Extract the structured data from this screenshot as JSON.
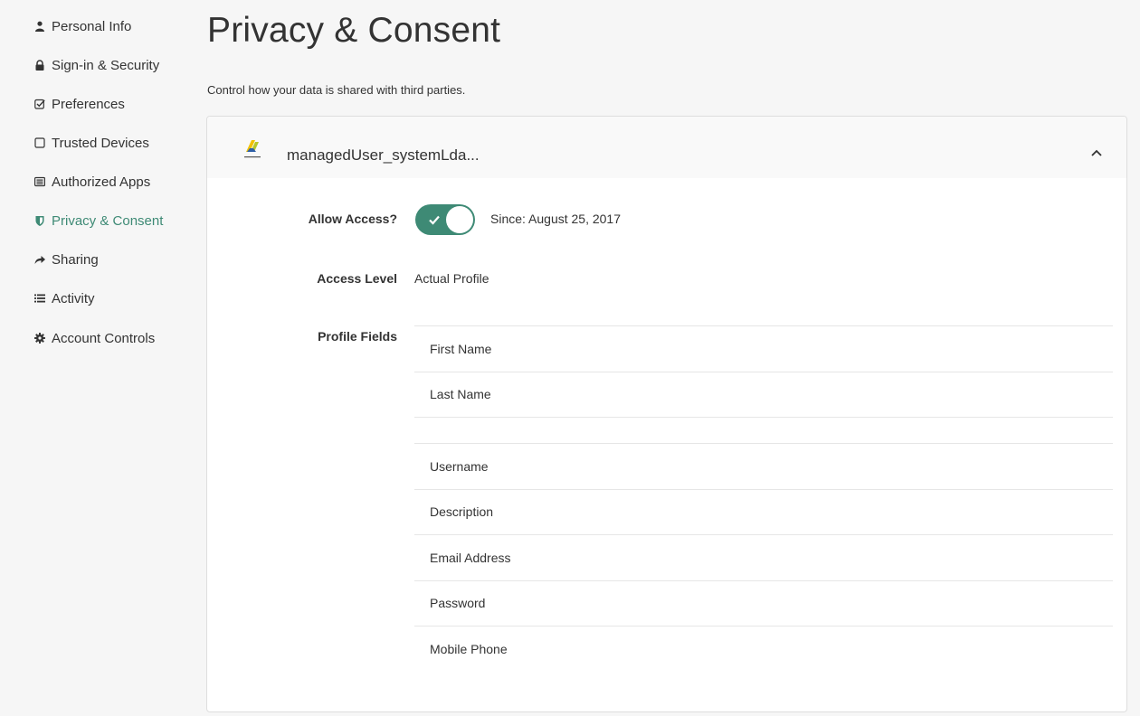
{
  "sidebar": {
    "items": [
      {
        "label": "Personal Info",
        "icon": "user-icon",
        "active": false
      },
      {
        "label": "Sign-in & Security",
        "icon": "lock-icon",
        "active": false
      },
      {
        "label": "Preferences",
        "icon": "checkbox-icon",
        "active": false
      },
      {
        "label": "Trusted Devices",
        "icon": "square-icon",
        "active": false
      },
      {
        "label": "Authorized Apps",
        "icon": "list-box-icon",
        "active": false
      },
      {
        "label": "Privacy & Consent",
        "icon": "shield-icon",
        "active": true
      },
      {
        "label": "Sharing",
        "icon": "share-icon",
        "active": false
      },
      {
        "label": "Activity",
        "icon": "list-icon",
        "active": false
      },
      {
        "label": "Account Controls",
        "icon": "gear-icon",
        "active": false
      }
    ]
  },
  "page": {
    "title": "Privacy & Consent",
    "subtitle": "Control how your data is shared with third parties."
  },
  "card": {
    "app_name": "managedUser_systemLda...",
    "allow_access_label": "Allow Access?",
    "allow_access_enabled": true,
    "since_text": "Since: August 25, 2017",
    "access_level_label": "Access Level",
    "access_level_value": "Actual Profile",
    "profile_fields_label": "Profile Fields",
    "profile_fields": [
      "First Name",
      "Last Name",
      "",
      "Username",
      "Description",
      "Email Address",
      "Password",
      "Mobile Phone"
    ]
  },
  "colors": {
    "accent": "#3e8a75",
    "background": "#f6f6f6",
    "card_header": "#f9f9f9"
  }
}
